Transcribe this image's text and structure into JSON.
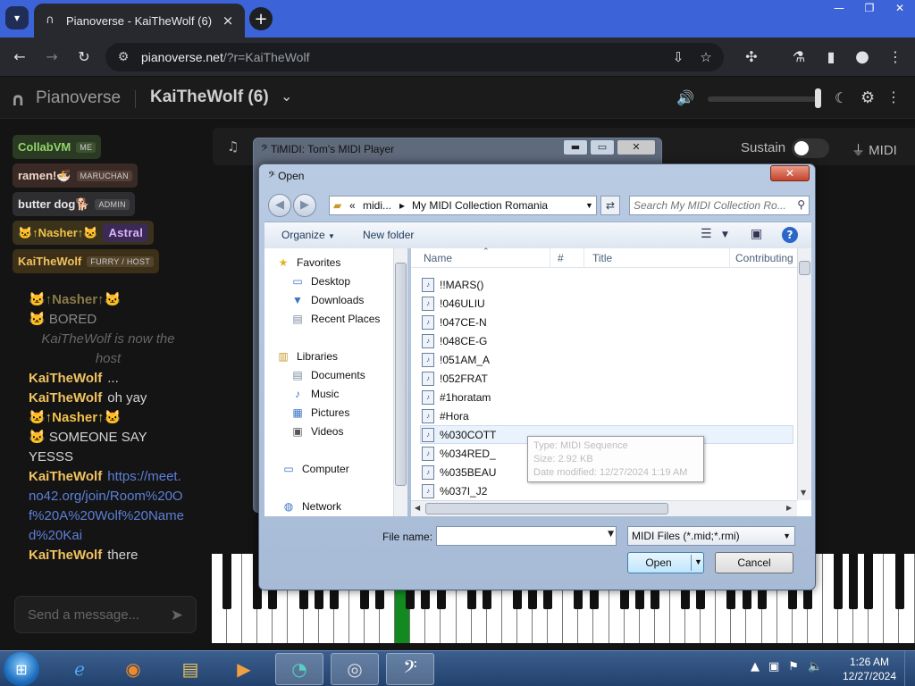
{
  "browser": {
    "tab_title": "Pianoverse - KaiTheWolf (6)",
    "url_host": "pianoverse.net",
    "url_path": "/?r=KaiTheWolf"
  },
  "app": {
    "logo": "Pianoverse",
    "room": "KaiTheWolf (6)",
    "sustain_label": "Sustain",
    "midi_label": "MIDI",
    "send_placeholder": "Send a message..."
  },
  "users": [
    {
      "name": "CollabVM",
      "badge": "ME",
      "bg": "#2b3a22",
      "color": "#8fd66a",
      "badge_bg": "#3d5230"
    },
    {
      "name": "ramen!🍜",
      "badge": "MARUCHAN",
      "bg": "#3a2a26",
      "color": "#f0d4c8",
      "badge_bg": "#544038"
    },
    {
      "name": "butter dog🐕",
      "badge": "ADMIN",
      "bg": "#2e2e30",
      "color": "#e6e6e6",
      "badge_bg": "#444448"
    },
    {
      "name": "🐱↑Nasher↑🐱",
      "badge": "Astral",
      "bg": "#3a321a",
      "color": "#f2c24a",
      "badge_bg": "#3b2a52"
    },
    {
      "name": "KaiTheWolf",
      "badge": "FURRY / HOST",
      "bg": "#3d3019",
      "color": "#f0c260",
      "badge_bg": "#54442c"
    }
  ],
  "chat": {
    "m1_name": "🐱↑Nasher↑🐱",
    "m1_text": "🐱 BORED",
    "sys": "KaiTheWolf is now the host",
    "m2_name": "KaiTheWolf",
    "m2_text": "...",
    "m3_name": "KaiTheWolf",
    "m3_text": "oh yay",
    "m4_name": "🐱↑Nasher↑🐱",
    "m4_text": "🐱 SOMEONE SAY YESSS",
    "m5_name": "KaiTheWolf",
    "m5_text": "https://meet.no42.org/join/Room%20Of%20A%20Wolf%20Named%20Kai",
    "m6_name": "KaiTheWolf",
    "m6_text": "there"
  },
  "timidity": {
    "title": "TiMIDI: Tom's MIDI Player"
  },
  "dialog": {
    "title": "Open",
    "crumb_1": "«",
    "crumb_2": "midi...",
    "crumb_3": "My MIDI Collection Romania",
    "search_placeholder": "Search My MIDI Collection Ro...",
    "organize": "Organize",
    "new_folder": "New folder",
    "nav": [
      {
        "label": "Favorites",
        "icon": "★",
        "color": "#e3b21e"
      },
      {
        "label": "Desktop",
        "icon": "▭",
        "color": "#3b73c4"
      },
      {
        "label": "Downloads",
        "icon": "▼",
        "color": "#3b73c4"
      },
      {
        "label": "Recent Places",
        "icon": "▤",
        "color": "#7a8aa0"
      },
      {
        "label": "Libraries",
        "icon": "▥",
        "color": "#c79a2c"
      },
      {
        "label": "Documents",
        "icon": "▤",
        "color": "#7a8aa0"
      },
      {
        "label": "Music",
        "icon": "♪",
        "color": "#3b73c4"
      },
      {
        "label": "Pictures",
        "icon": "▦",
        "color": "#3b73c4"
      },
      {
        "label": "Videos",
        "icon": "▣",
        "color": "#555"
      },
      {
        "label": "Computer",
        "icon": "▭",
        "color": "#3b73c4"
      },
      {
        "label": "Network",
        "icon": "◍",
        "color": "#3b73c4"
      }
    ],
    "col_name": "Name",
    "col_num": "#",
    "col_title": "Title",
    "col_contrib": "Contributing",
    "files": [
      "!!MARS()",
      "!046ULIU",
      "!047CE-N",
      "!048CE-G",
      "!051AM_A",
      "!052FRAT",
      "#1horatam",
      "#Hora",
      "%030COTT",
      "%034RED_",
      "%035BEAU",
      "%037I_J2"
    ],
    "tooltip_type": "Type: MIDI Sequence",
    "tooltip_size": "Size: 2.92 KB",
    "tooltip_date": "Date modified: 12/27/2024 1:19 AM",
    "file_name_label": "File name:",
    "file_type": "MIDI Files (*.mid;*.rmi)",
    "open_label": "Open",
    "cancel_label": "Cancel"
  },
  "taskbar": {
    "time": "1:26 AM",
    "date": "12/27/2024"
  }
}
